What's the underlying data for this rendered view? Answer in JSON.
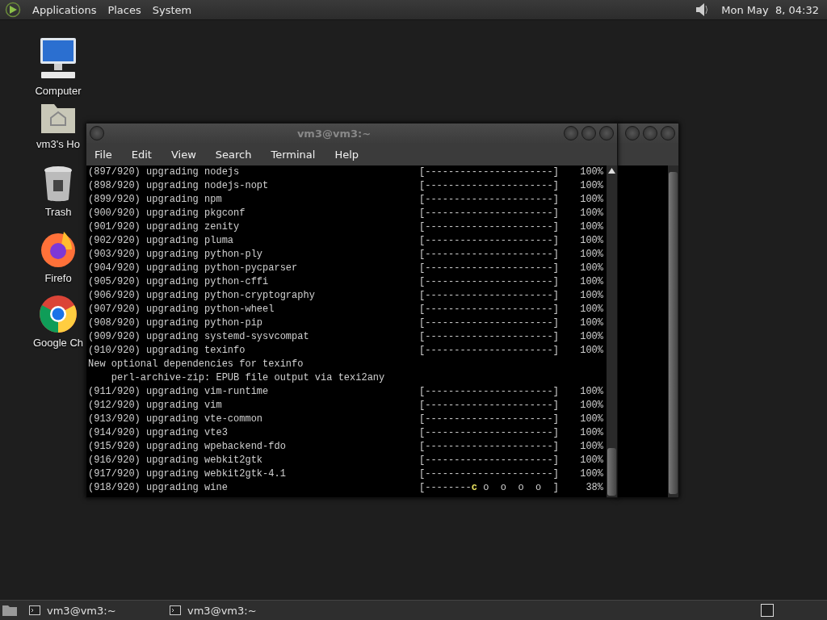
{
  "top_panel": {
    "menus": [
      "Applications",
      "Places",
      "System"
    ],
    "clock": "Mon May  8, 04:32"
  },
  "desktop_icons": [
    {
      "kind": "computer",
      "label": "Computer"
    },
    {
      "kind": "home",
      "label": "vm3's Ho"
    },
    {
      "kind": "trash",
      "label": "Trash"
    },
    {
      "kind": "firefox",
      "label": "Firefo"
    },
    {
      "kind": "chrome",
      "label": "Google Ch"
    }
  ],
  "terminal": {
    "title": "vm3@vm3:~",
    "menus": [
      "File",
      "Edit",
      "View",
      "Search",
      "Terminal",
      "Help"
    ],
    "lines": [
      {
        "kind": "progress",
        "text": "(897/920) upgrading nodejs",
        "bar": "[----------------------]",
        "percent": "100%"
      },
      {
        "kind": "progress",
        "text": "(898/920) upgrading nodejs-nopt",
        "bar": "[----------------------]",
        "percent": "100%"
      },
      {
        "kind": "progress",
        "text": "(899/920) upgrading npm",
        "bar": "[----------------------]",
        "percent": "100%"
      },
      {
        "kind": "progress",
        "text": "(900/920) upgrading pkgconf",
        "bar": "[----------------------]",
        "percent": "100%"
      },
      {
        "kind": "progress",
        "text": "(901/920) upgrading zenity",
        "bar": "[----------------------]",
        "percent": "100%"
      },
      {
        "kind": "progress",
        "text": "(902/920) upgrading pluma",
        "bar": "[----------------------]",
        "percent": "100%"
      },
      {
        "kind": "progress",
        "text": "(903/920) upgrading python-ply",
        "bar": "[----------------------]",
        "percent": "100%"
      },
      {
        "kind": "progress",
        "text": "(904/920) upgrading python-pycparser",
        "bar": "[----------------------]",
        "percent": "100%"
      },
      {
        "kind": "progress",
        "text": "(905/920) upgrading python-cffi",
        "bar": "[----------------------]",
        "percent": "100%"
      },
      {
        "kind": "progress",
        "text": "(906/920) upgrading python-cryptography",
        "bar": "[----------------------]",
        "percent": "100%"
      },
      {
        "kind": "progress",
        "text": "(907/920) upgrading python-wheel",
        "bar": "[----------------------]",
        "percent": "100%"
      },
      {
        "kind": "progress",
        "text": "(908/920) upgrading python-pip",
        "bar": "[----------------------]",
        "percent": "100%"
      },
      {
        "kind": "progress",
        "text": "(909/920) upgrading systemd-sysvcompat",
        "bar": "[----------------------]",
        "percent": "100%"
      },
      {
        "kind": "progress",
        "text": "(910/920) upgrading texinfo",
        "bar": "[----------------------]",
        "percent": "100%"
      },
      {
        "kind": "text",
        "text": "New optional dependencies for texinfo"
      },
      {
        "kind": "text",
        "text": "    perl-archive-zip: EPUB file output via texi2any"
      },
      {
        "kind": "progress",
        "text": "(911/920) upgrading vim-runtime",
        "bar": "[----------------------]",
        "percent": "100%"
      },
      {
        "kind": "progress",
        "text": "(912/920) upgrading vim",
        "bar": "[----------------------]",
        "percent": "100%"
      },
      {
        "kind": "progress",
        "text": "(913/920) upgrading vte-common",
        "bar": "[----------------------]",
        "percent": "100%"
      },
      {
        "kind": "progress",
        "text": "(914/920) upgrading vte3",
        "bar": "[----------------------]",
        "percent": "100%"
      },
      {
        "kind": "progress",
        "text": "(915/920) upgrading wpebackend-fdo",
        "bar": "[----------------------]",
        "percent": "100%"
      },
      {
        "kind": "progress",
        "text": "(916/920) upgrading webkit2gtk",
        "bar": "[----------------------]",
        "percent": "100%"
      },
      {
        "kind": "progress",
        "text": "(917/920) upgrading webkit2gtk-4.1",
        "bar": "[----------------------]",
        "percent": "100%"
      },
      {
        "kind": "pacman",
        "text": "(918/920) upgrading wine",
        "bar": "[--------",
        "pacman": "c",
        "bar_rest": " o  o  o  o  ]",
        "percent": "38%"
      }
    ]
  },
  "taskbar": {
    "tasks": [
      "vm3@vm3:~",
      "vm3@vm3:~"
    ]
  }
}
